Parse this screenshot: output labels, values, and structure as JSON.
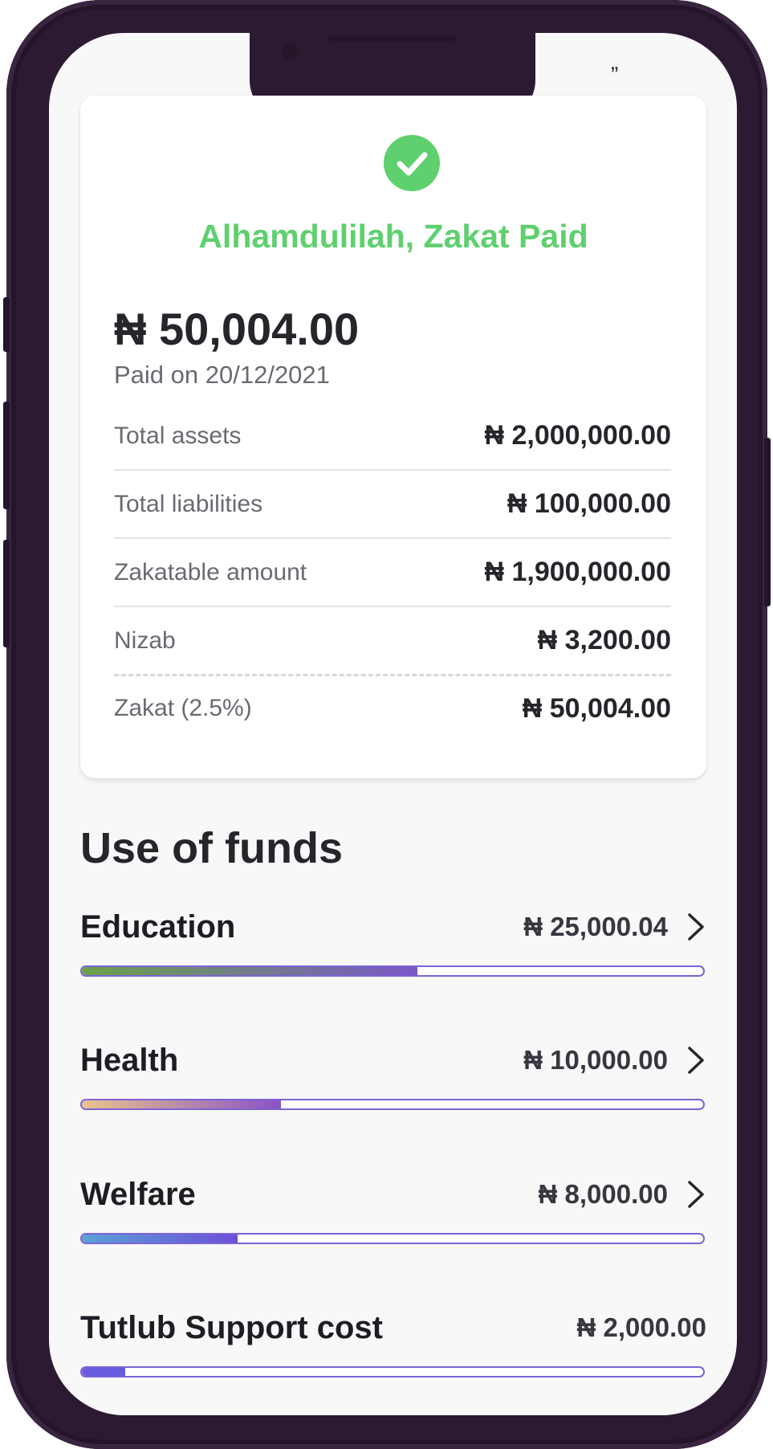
{
  "status_bar": {
    "glyph": "„"
  },
  "summary": {
    "status_title": "Alhamdulilah, Zakat Paid",
    "total_amount": "₦ 50,004.00",
    "paid_on": "Paid on 20/12/2021",
    "rows": [
      {
        "label": "Total assets",
        "value": "₦ 2,000,000.00"
      },
      {
        "label": "Total liabilities",
        "value": "₦ 100,000.00"
      },
      {
        "label": "Zakatable amount",
        "value": "₦ 1,900,000.00"
      },
      {
        "label": "Nizab",
        "value": "₦ 3,200.00"
      },
      {
        "label": "Zakat (2.5%)",
        "value": "₦ 50,004.00"
      }
    ]
  },
  "funds": {
    "title": "Use of funds",
    "items": [
      {
        "name": "Education",
        "amount": "₦ 25,000.04",
        "fraction": 0.54,
        "gradient": [
          "#6aa24a",
          "#7b58c8"
        ],
        "chevron": true
      },
      {
        "name": "Health",
        "amount": "₦ 10,000.00",
        "fraction": 0.32,
        "gradient": [
          "#e9c48e",
          "#8a52c6"
        ],
        "chevron": true
      },
      {
        "name": "Welfare",
        "amount": "₦ 8,000.00",
        "fraction": 0.25,
        "gradient": [
          "#5aa2d6",
          "#6d4ed8"
        ],
        "chevron": true
      },
      {
        "name": "Tutlub Support cost",
        "amount": "₦ 2,000.00",
        "fraction": 0.07,
        "gradient": [
          "#6a5ce0",
          "#6a5ce0"
        ],
        "chevron": false
      }
    ]
  },
  "colors": {
    "success": "#5ed06e",
    "frame": "#2c1a33",
    "track_border": "#7b63d6"
  }
}
